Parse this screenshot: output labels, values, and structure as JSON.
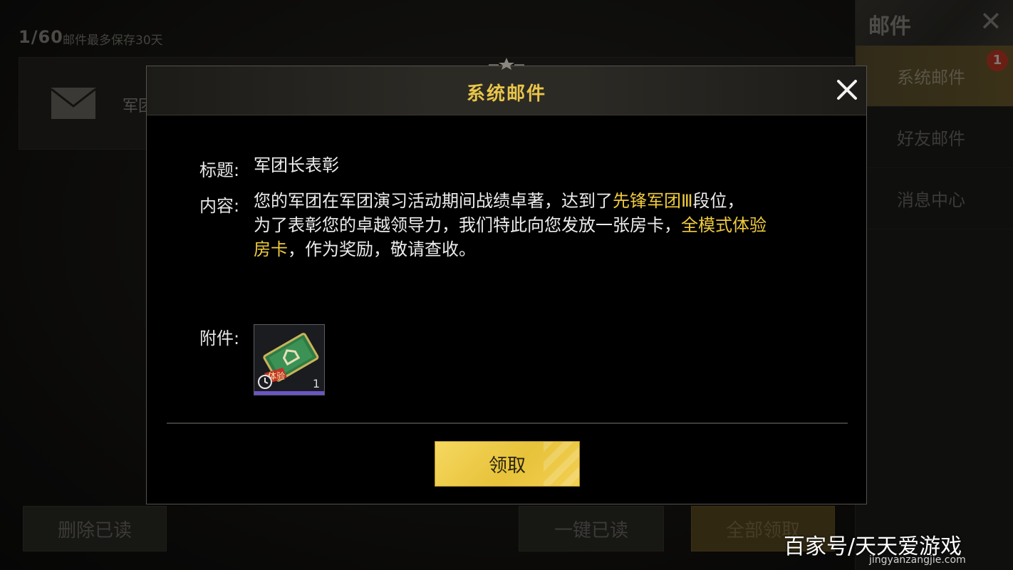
{
  "background": {
    "mail_count": "1/60",
    "mail_keep_note": "邮件最多保存30天",
    "mail_row_title": "军团",
    "buttons": {
      "delete_read": "删除已读",
      "mark_all_read": "一键已读",
      "claim_all": "全部领取"
    }
  },
  "side_panel": {
    "title": "邮件",
    "tabs": [
      {
        "label": "系统邮件",
        "active": true,
        "badge": "1"
      },
      {
        "label": "好友邮件",
        "active": false
      },
      {
        "label": "消息中心",
        "active": false
      }
    ]
  },
  "modal": {
    "title": "系统邮件",
    "subject_label": "标题:",
    "subject_value": "军团长表彰",
    "content_label": "内容:",
    "content_parts": {
      "p1": "您的军团在军团演习活动期间战绩卓著，达到了",
      "hl1": "先锋军团Ⅲ",
      "p2": "段位，",
      "p3": "为了表彰您的卓越领导力，我们特此向您发放一张房卡，",
      "hl2a": "全模式体验",
      "hl2b": "房卡",
      "p4": "，作为奖励，敬请查收。"
    },
    "attachment_label": "附件:",
    "attachment_item": {
      "name": "全模式体验房卡",
      "tag": "体验",
      "quantity": "1"
    },
    "claim_button": "领取"
  },
  "watermark": {
    "text": "百家号/天天爱游戏",
    "sub": "jingyanzangjie.com"
  },
  "colors": {
    "gold_text": "#efcb3e",
    "button_gold": "#e7c23a",
    "rarity_bar": "#6a55c9",
    "badge_red": "#c13a26"
  }
}
